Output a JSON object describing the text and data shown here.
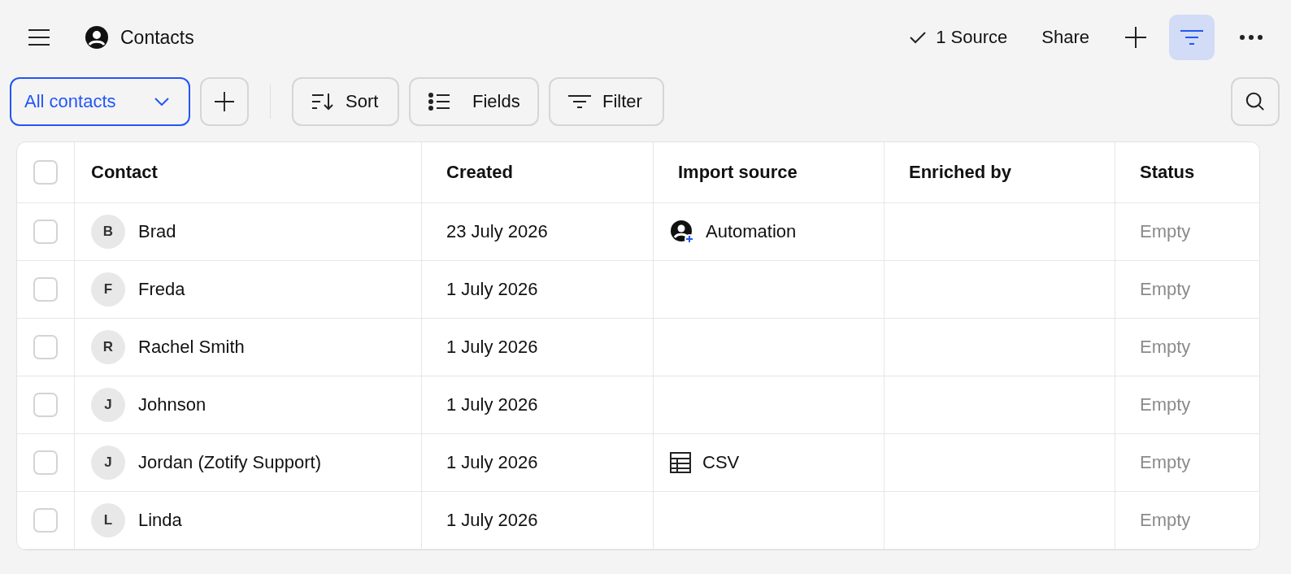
{
  "topbar": {
    "title": "Contacts",
    "source": "1 Source",
    "share": "Share",
    "filter_active": true
  },
  "toolbar": {
    "view": "All contacts",
    "sort": "Sort",
    "fields": "Fields",
    "filter": "Filter"
  },
  "table": {
    "header_checked": false,
    "columns": [
      "Contact",
      "Created",
      "Import source",
      "Enriched by",
      "Status"
    ],
    "rows": [
      {
        "checked": false,
        "initial": "B",
        "contact": "Brad",
        "created": "23 July 2026",
        "import_source": {
          "kind": "automation",
          "label": "Automation"
        },
        "status": "Empty"
      },
      {
        "checked": false,
        "initial": "F",
        "contact": "Freda",
        "created": "1 July 2026",
        "status": "Empty"
      },
      {
        "checked": false,
        "initial": "R",
        "contact": "Rachel Smith",
        "created": "1 July 2026",
        "status": "Empty"
      },
      {
        "checked": false,
        "initial": "J",
        "contact": "Johnson",
        "created": "1 July 2026",
        "status": "Empty"
      },
      {
        "checked": false,
        "initial": "J",
        "contact": "Jordan (Zotify Support)",
        "created": "1 July 2026",
        "import_source": {
          "kind": "csv",
          "label": "CSV"
        },
        "status": "Empty"
      },
      {
        "checked": false,
        "initial": "L",
        "contact": "Linda",
        "created": "1 July 2026",
        "status": "Empty"
      }
    ]
  }
}
